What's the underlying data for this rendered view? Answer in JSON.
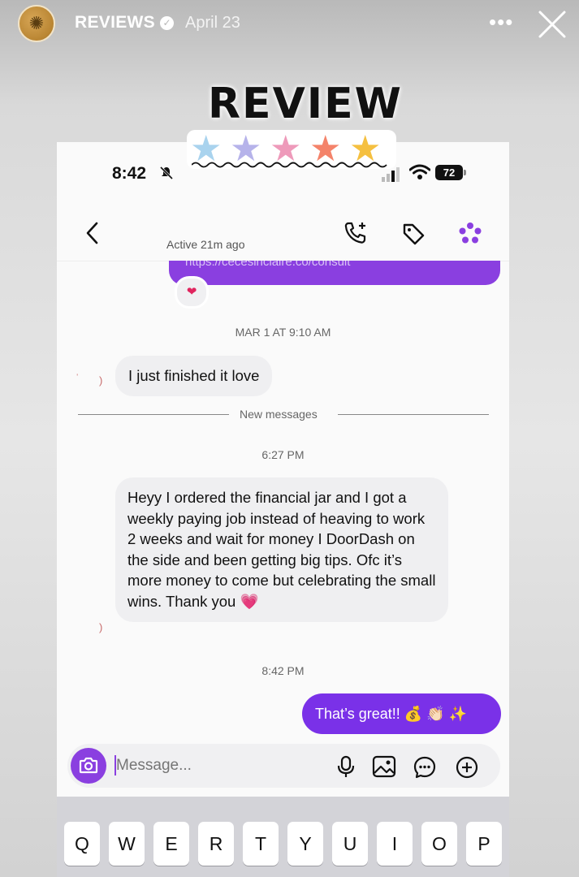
{
  "story": {
    "account": "REVIEWS",
    "date": "April 23",
    "more_label": "•••"
  },
  "sticker": {
    "title": "REVIEW",
    "stars": [
      {
        "color": "#a9d3ee"
      },
      {
        "color": "#b6b3ea"
      },
      {
        "color": "#ee9aba"
      },
      {
        "color": "#f4836a"
      },
      {
        "color": "#f5c040"
      }
    ]
  },
  "status_bar": {
    "time": "8:42",
    "battery": "72"
  },
  "chat_header": {
    "active_status": "Active 21m ago"
  },
  "messages": {
    "link_preview": "https://cecesinclaire.co/consult",
    "reaction": "❤",
    "timestamp_1": "MAR 1 AT 9:10 AM",
    "incoming_1": "I just finished it love",
    "new_messages_label": "New messages",
    "timestamp_2": "6:27 PM",
    "incoming_2": "Heyy I ordered the financial jar and I got a weekly paying job instead of heaving to work 2 weeks and wait for money I DoorDash on the side and been getting big tips. Ofc it’s more money to come but celebrating the small wins. Thank you 💗",
    "timestamp_3": "8:42 PM",
    "outgoing_1": "That’s great!! 💰 👏🏻 ✨"
  },
  "composer": {
    "placeholder": "Message..."
  },
  "keyboard": {
    "row1": [
      "Q",
      "W",
      "E",
      "R",
      "T",
      "Y",
      "U",
      "I",
      "O",
      "P"
    ]
  }
}
